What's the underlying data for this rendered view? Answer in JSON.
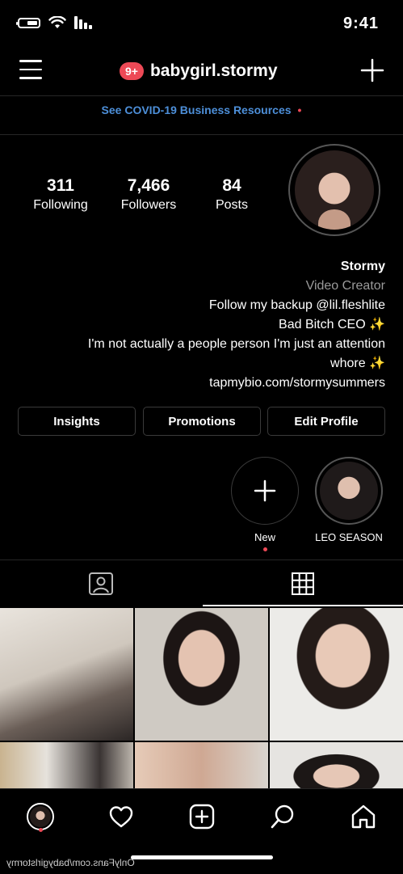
{
  "status_bar": {
    "time": "9:41"
  },
  "header": {
    "username": "babygirl.stormy",
    "notif_badge": "9+"
  },
  "banner": {
    "text": "See COVID-19 Business Resources"
  },
  "stats": [
    {
      "value": "84",
      "label": "Posts"
    },
    {
      "value": "7,466",
      "label": "Followers"
    },
    {
      "value": "311",
      "label": "Following"
    }
  ],
  "bio": {
    "name": "Stormy",
    "category": "Video Creator",
    "line1": "Follow my backup @lil.fleshlite",
    "line2": "Bad Bitch CEO ✨",
    "line3": "I'm not actually a people person I'm just an attention",
    "line4": "whore ✨",
    "link": "tapmybio.com/stormysummers"
  },
  "buttons": {
    "edit_profile": "Edit Profile",
    "promotions": "Promotions",
    "insights": "Insights"
  },
  "highlights": [
    {
      "label": "LEO SEASON"
    },
    {
      "label": "New"
    }
  ],
  "tabs": {
    "active": "grid",
    "icons": [
      "grid-icon",
      "tagged-icon"
    ]
  },
  "nav": {
    "icons": [
      "home-icon",
      "search-icon",
      "new-post-icon",
      "activity-icon",
      "profile-icon"
    ]
  },
  "watermark": "OnlyFans.com/babygirlstormy",
  "colors": {
    "accent_red": "#ed4956",
    "link_blue": "#4d8fd9",
    "background": "#000000"
  }
}
